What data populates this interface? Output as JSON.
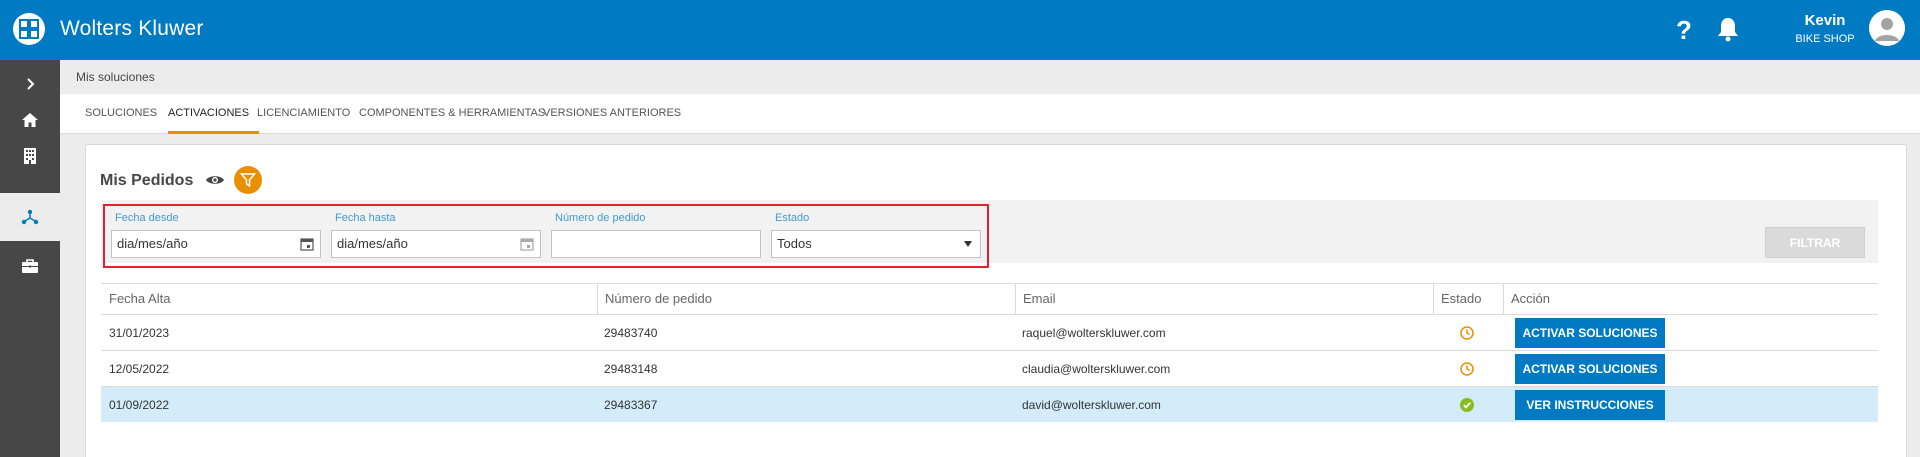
{
  "header": {
    "brand": "Wolters Kluwer",
    "help_symbol": "?",
    "user_name": "Kevin",
    "user_company": "BIKE SHOP",
    "colors": {
      "primary": "#007ac3",
      "accent": "#ea8f00"
    }
  },
  "sidebar": {
    "items": [
      {
        "icon": "chevron-right-icon"
      },
      {
        "icon": "home-icon"
      },
      {
        "icon": "building-icon"
      },
      {
        "icon": "network-icon",
        "active": true
      },
      {
        "icon": "briefcase-icon"
      }
    ]
  },
  "breadcrumb": "Mis soluciones",
  "tabs": [
    {
      "label": "SOLUCIONES"
    },
    {
      "label": "ACTIVACIONES",
      "active": true
    },
    {
      "label": "LICENCIAMIENTO"
    },
    {
      "label": "COMPONENTES & HERRAMIENTAS"
    },
    {
      "label": "VERSIONES ANTERIORES"
    }
  ],
  "section": {
    "title": "Mis Pedidos"
  },
  "filters": {
    "fecha_desde_label": "Fecha desde",
    "fecha_desde_value": "dia/mes/año",
    "fecha_hasta_label": "Fecha hasta",
    "fecha_hasta_value": "dia/mes/año",
    "numero_pedido_label": "Número de pedido",
    "numero_pedido_value": "",
    "estado_label": "Estado",
    "estado_value": "Todos",
    "filter_button": "FILTRAR"
  },
  "table": {
    "headers": [
      "Fecha Alta",
      "Número de pedido",
      "Email",
      "Estado",
      "Acción"
    ],
    "rows": [
      {
        "fecha": "31/01/2023",
        "pedido": "29483740",
        "email": "raquel@wolterskluwer.com",
        "estado": "pending",
        "action": "ACTIVAR SOLUCIONES"
      },
      {
        "fecha": "12/05/2022",
        "pedido": "29483148",
        "email": "claudia@wolterskluwer.com",
        "estado": "pending",
        "action": "ACTIVAR SOLUCIONES"
      },
      {
        "fecha": "01/09/2022",
        "pedido": "29483367",
        "email": "david@wolterskluwer.com",
        "estado": "completed",
        "action": "VER INSTRUCCIONES",
        "selected": true
      }
    ]
  }
}
